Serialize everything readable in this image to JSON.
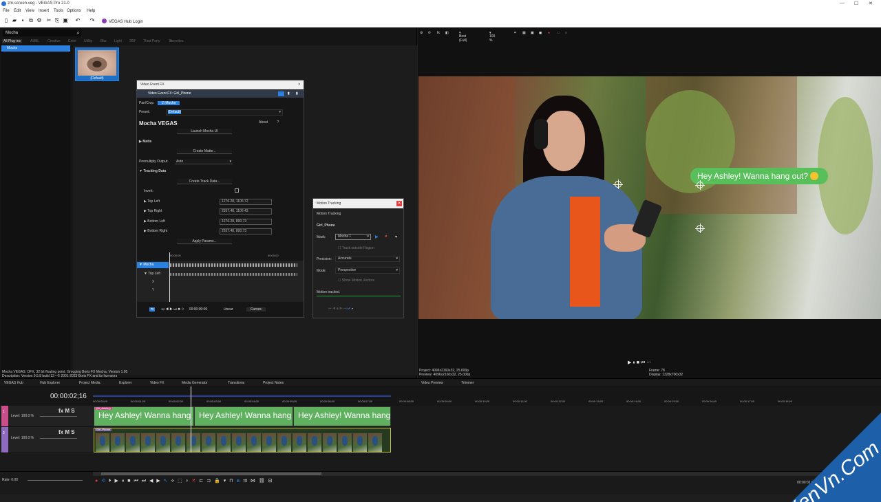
{
  "window": {
    "title": "zm-screen.veg - VEGAS Pro 21.0",
    "minimize": "—",
    "maximize": "☐",
    "close": "✕"
  },
  "menu": [
    "File",
    "Edit",
    "View",
    "Insert",
    "Tools",
    "Options",
    "Help"
  ],
  "toolbar": {
    "hub_login": "VEGAS Hub Login"
  },
  "plugins": {
    "search_value": "Mocha",
    "tabs": [
      "All Plug-ins",
      "AI/ML",
      "Creative",
      "Color",
      "Utility",
      "Blur",
      "Light",
      "360°",
      "Third Party",
      "Favorites"
    ],
    "list_selected": "Mocha",
    "thumb_label": "(Default)",
    "description": "Mocha VEGAS: OFX, 32 bit floating point, Grouping Boris FX Mocha, Version 1.95",
    "description2": "Description: Version 9.5.8 build 13 • © 2001-2023 Boris FX and its licensors"
  },
  "fx_window": {
    "title": "Video Event FX",
    "header": "Video Event FX: Girl_Phone",
    "chain_pan": "Pan/Crop",
    "chain_mocha": "Mocha",
    "preset_label": "Preset:",
    "preset_value": "(Default)",
    "plugin_name": "Mocha VEGAS",
    "about": "About",
    "about_q": "?",
    "launch": "Launch Mocha UI",
    "matte": "Matte",
    "create_matte": "Create Matte...",
    "premultiply_label": "Premultiply Output:",
    "premultiply_value": "Auto",
    "tracking_data": "Tracking Data",
    "create_track": "Create Track Data...",
    "invert": "Invert:",
    "top_left": "Top Left",
    "top_left_val": "1276.28, 1106.72",
    "top_right": "Top Right",
    "top_right_val": "2557.48, 1106.43",
    "bottom_left": "Bottom Left",
    "bottom_left_val": "1276.28, 800.73",
    "bottom_right": "Bottom Right",
    "bottom_right_val": "2557.48, 800.73",
    "apply_params": "Apply Params...",
    "tl_mocha": "Mocha",
    "tl_topleft": "Top Left",
    "tl_time0": "00:00:00",
    "tl_time1": "00:00:02",
    "tl_x": "X",
    "tl_y": "Y",
    "time": "00:00:00:00",
    "linear": "Linear",
    "curves": "Curves"
  },
  "motion_window": {
    "title": "Motion Tracking",
    "subtitle": "Motion Tracking",
    "event": "Girl_Phone",
    "mask_label": "Mask:",
    "mask_value": "Mocha 1",
    "track_outside": "Track outside Region",
    "precision_label": "Precision:",
    "precision_value": "Accurate",
    "mode_label": "Mode:",
    "mode_value": "Perspective",
    "show_motion": "Show Motion Vectors",
    "motion_tracked": "Motion tracked."
  },
  "preview": {
    "quality": "Best (Full)",
    "zoom": "100 %",
    "bubble_text": "Hey Ashley! Wanna hang out?",
    "project": "Project:  4096x2160x32, 25.000p",
    "preview_res": "Preview:  4096x2160x32, 25.000p",
    "frame": "Frame:  78",
    "display": "Display:  1328x700x32"
  },
  "dock_tabs": [
    "VEGAS Hub",
    "Hub Explorer",
    "Project Media",
    "Explorer",
    "Video FX",
    "Media Generator",
    "Transitions",
    "Project Notes",
    "Video Preview",
    "Trimmer"
  ],
  "timeline": {
    "timecode": "00:00:02;16",
    "ruler": [
      "00:00:00;00",
      "00:00:01;00",
      "00:00:02;00",
      "00:00:03;00",
      "00:00:04;00",
      "00:00:05;00",
      "00:00:06;00",
      "00:00:07;00",
      "00:00:08;00",
      "00:00:09;00",
      "00:00:10;00",
      "00:00:11;00",
      "00:00:12;00",
      "00:00:13;00",
      "00:00:14;00",
      "00:00:15;00",
      "00:00:16;00",
      "00:00:17;00",
      "00:00:18;00"
    ],
    "track1": {
      "num": "1",
      "level": "Level: 100.0 %",
      "clip_name": "(Hi_Ashley)",
      "clip_text": "Hey Ashley! Wanna hang"
    },
    "track2": {
      "num": "2",
      "level": "Level: 100.0 %",
      "clip_name": "Girl_Phone"
    },
    "fx_m_s": "fx M S"
  },
  "bottom": {
    "rate": "Rate: 0.00",
    "time": "00:00:02;16",
    "record_time": "Record Time (2 channels): 0:22:43:00"
  },
  "watermark": "XenVn.Com",
  "colors": {
    "accent": "#2a81e0",
    "bubble": "#59bf5a",
    "track1": "#c94f8a",
    "track2": "#8e6bbf"
  }
}
